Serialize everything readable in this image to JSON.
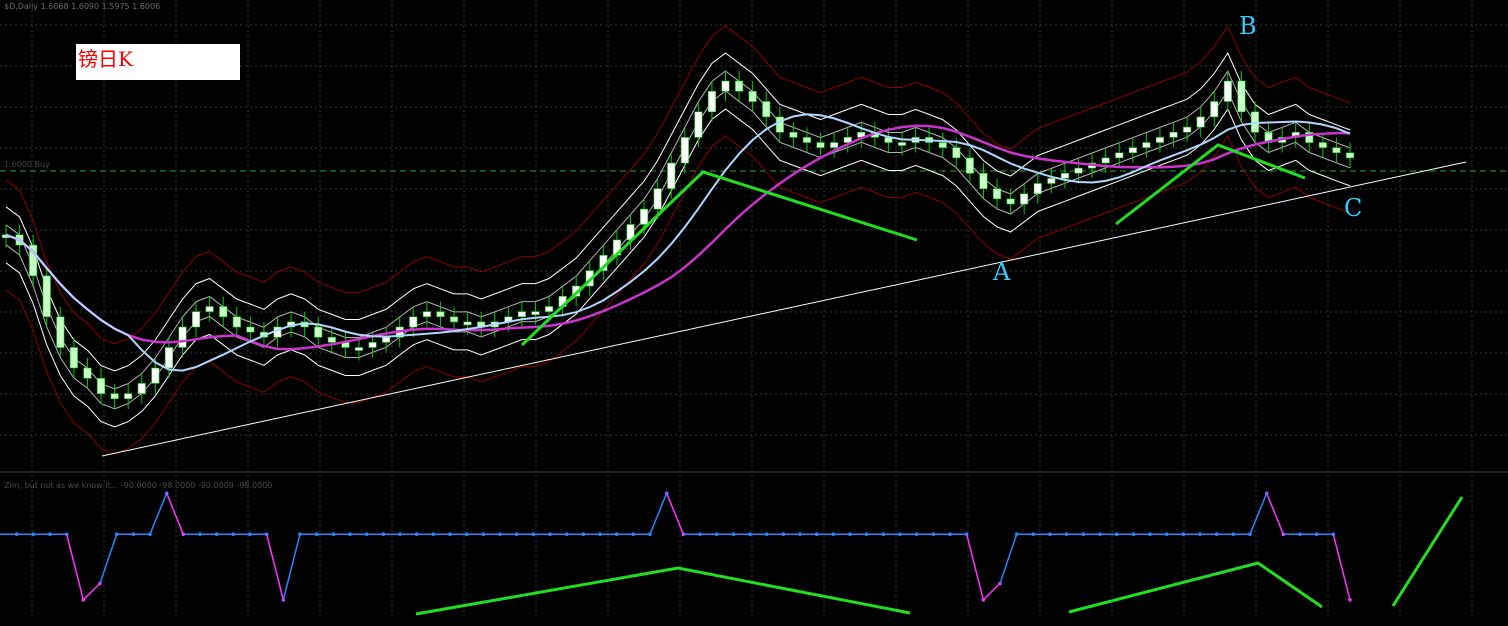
{
  "header": {
    "symbol_text": "$D,Daily  1.6068 1.6090 1.5975 1.6006",
    "label": "镑日K"
  },
  "subwindow": {
    "title": "Zim, but not as we know it... -90.0000 -98.0000 -90.0009 -98.0000"
  },
  "price_tag": "1.6000 Buy",
  "points": {
    "a": "A",
    "b": "B",
    "c": "C"
  },
  "colors": {
    "background": "#000000",
    "grid": "#2e3a3a",
    "candle_up": "#ffffff",
    "candle_down": "#c8ffc8",
    "candle_outline": "#00cc00",
    "envelope": "#ffffff",
    "bands": "#8b0000",
    "ma_slow": "#cc33cc",
    "ma_fast": "#b0d8ff",
    "trend_line": "#ffffff",
    "annotation": "#22dd22",
    "label_color": "#33ccff",
    "dashed_level": "#2fa02f",
    "osc_blue": "#2288ff",
    "osc_magenta": "#ff33ff"
  },
  "chart_data": {
    "type": "candlestick",
    "series": [
      {
        "name": "price",
        "close": [
          62,
          60,
          54,
          46,
          40,
          36,
          34,
          31,
          30,
          31,
          33,
          36,
          40,
          44,
          47,
          48,
          46,
          44,
          43,
          42,
          44,
          45,
          44,
          42,
          41,
          40,
          40,
          41,
          42,
          44,
          46,
          47,
          46,
          45,
          45,
          44,
          45,
          46,
          47,
          47,
          48,
          50,
          52,
          55,
          58,
          61,
          64,
          67,
          71,
          76,
          81,
          86,
          90,
          92,
          90,
          88,
          85,
          82,
          81,
          80,
          79,
          80,
          81,
          82,
          81,
          80,
          80,
          81,
          80,
          79,
          77,
          74,
          71,
          69,
          68,
          70,
          72,
          73,
          74,
          75,
          76,
          77,
          78,
          79,
          80,
          81,
          82,
          83,
          85,
          88,
          92,
          86,
          82,
          80,
          81,
          82,
          80,
          79,
          78,
          77
        ]
      }
    ],
    "oscillator": {
      "values": [
        -10,
        -10,
        -10,
        -10,
        -10,
        -90,
        -70,
        -10,
        -10,
        -10,
        40,
        -10,
        -10,
        -10,
        -10,
        -10,
        -10,
        -90,
        -10,
        -10,
        -10,
        -10,
        -10,
        -10,
        -10,
        -10,
        -10,
        -10,
        -10,
        -10,
        -10,
        -10,
        -10,
        -10,
        -10,
        -10,
        -10,
        -10,
        -10,
        -10,
        40,
        -10,
        -10,
        -10,
        -10,
        -10,
        -10,
        -10,
        -10,
        -10,
        -10,
        -10,
        -10,
        -10,
        -10,
        -10,
        -10,
        -10,
        -10,
        -90,
        -70,
        -10,
        -10,
        -10,
        -10,
        -10,
        -10,
        -10,
        -10,
        -10,
        -10,
        -10,
        -10,
        -10,
        -10,
        -10,
        40,
        -10,
        -10,
        -10,
        -10,
        -90
      ],
      "range": [
        -100,
        50
      ]
    }
  }
}
